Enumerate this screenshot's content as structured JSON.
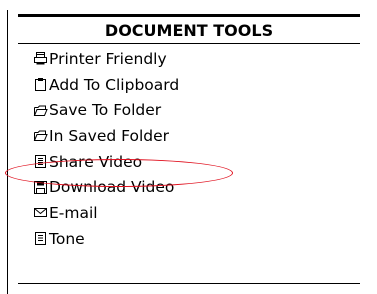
{
  "panel": {
    "title": "DOCUMENT TOOLS",
    "items": [
      {
        "label": "Printer Friendly",
        "icon": "printer-icon"
      },
      {
        "label": "Add To Clipboard",
        "icon": "clipboard-icon"
      },
      {
        "label": "Save To Folder",
        "icon": "folder-icon"
      },
      {
        "label": "In Saved Folder",
        "icon": "folder-icon"
      },
      {
        "label": "Share Video",
        "icon": "document-icon"
      },
      {
        "label": "Download Video",
        "icon": "save-disk-icon"
      },
      {
        "label": "E-mail",
        "icon": "envelope-icon"
      },
      {
        "label": "Tone",
        "icon": "document-lines-icon"
      }
    ],
    "highlighted_item": "Share Video",
    "highlight_color": "#e0101e"
  }
}
